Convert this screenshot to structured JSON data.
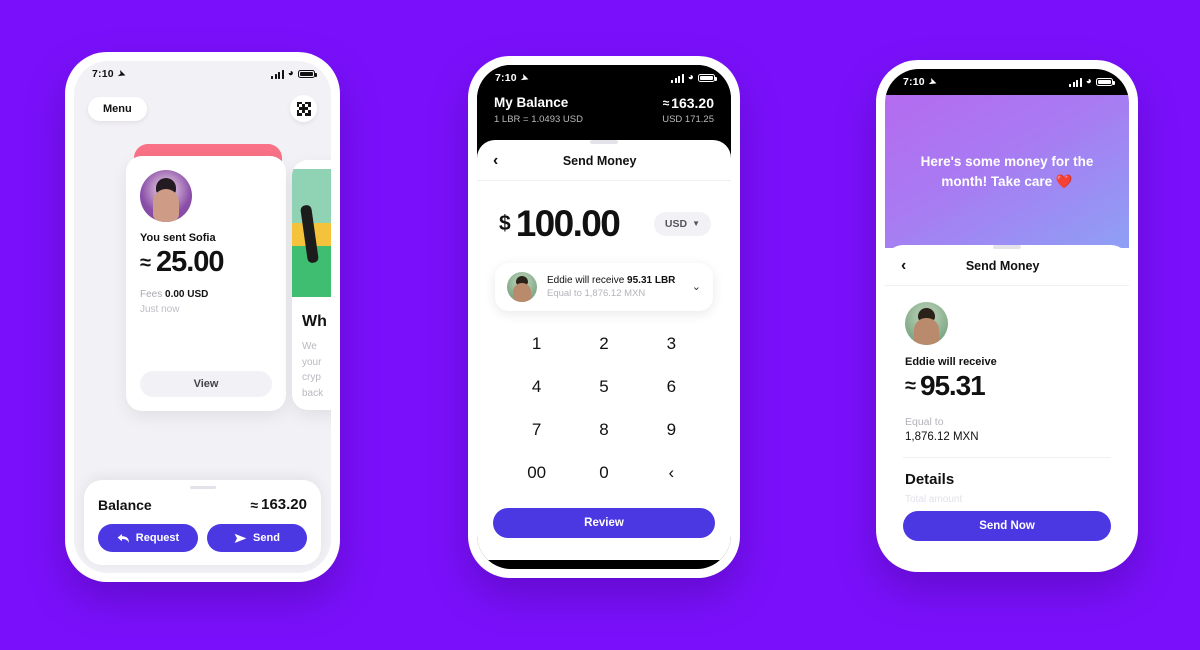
{
  "theme": {
    "background": "#7A10FB",
    "accent": "#4B38E2",
    "pink_card": "#F97186",
    "sheet_bg": "#FFFFFF",
    "screen_bg": "#F2F1F6"
  },
  "phone1": {
    "status": {
      "time": "7:10",
      "location_icon": "location-arrow-icon",
      "signal_icon": "cellular-bars-icon",
      "wifi_icon": "wifi-icon",
      "battery_icon": "battery-icon"
    },
    "menu_button": "Menu",
    "qr_button": "qr-code-icon",
    "receipt_card": {
      "avatar": "sofia-avatar",
      "title": "You sent Sofia",
      "currency_symbol": "≈",
      "amount": "25.00",
      "fees_label": "Fees",
      "fees_value": "0.00 USD",
      "timestamp": "Just now",
      "view_button": "View"
    },
    "peek_card": {
      "title": "Wh",
      "lines": [
        "We ",
        "your",
        "cryp",
        "back"
      ]
    },
    "balance_bar": {
      "label": "Balance",
      "currency_symbol": "≈",
      "value": "163.20",
      "request_button": "Request",
      "request_icon": "reply-arrow-icon",
      "send_button": "Send",
      "send_icon": "paper-plane-icon"
    }
  },
  "phone2": {
    "status": {
      "time": "7:10",
      "location_icon": "location-arrow-icon",
      "signal_icon": "cellular-bars-icon",
      "wifi_icon": "wifi-icon",
      "battery_icon": "battery-icon"
    },
    "header": {
      "title": "My Balance",
      "rate": "1 LBR = 1.0493 USD",
      "currency_symbol": "≈",
      "balance": "163.20",
      "usd_value": "USD 171.25"
    },
    "nav": {
      "back_icon": "chevron-left-icon",
      "title": "Send Money"
    },
    "amount": {
      "symbol": "$",
      "value": "100.00",
      "currency": "USD",
      "chevron": "chevron-down-icon"
    },
    "recipient_card": {
      "avatar": "eddie-avatar",
      "line1_prefix": "Eddie will receive ",
      "line1_amount": "95.31 LBR",
      "line2": "Equal to 1,876.12 MXN",
      "expand_icon": "chevron-down-icon"
    },
    "keypad": [
      "1",
      "2",
      "3",
      "4",
      "5",
      "6",
      "7",
      "8",
      "9",
      "00",
      "0",
      "‹"
    ],
    "review_button": "Review"
  },
  "phone3": {
    "status": {
      "time": "7:10",
      "location_icon": "location-arrow-icon",
      "signal_icon": "cellular-bars-icon",
      "wifi_icon": "wifi-icon",
      "battery_icon": "battery-icon"
    },
    "message": "Here's some money for the month! Take care ❤️",
    "nav": {
      "back_icon": "chevron-left-icon",
      "title": "Send Money"
    },
    "avatar": "eddie-avatar",
    "receive_label": "Eddie will receive",
    "currency_symbol": "≈",
    "receive_amount": "95.31",
    "equal_label": "Equal to",
    "equal_value": "1,876.12 MXN",
    "details_heading": "Details",
    "details_faint": "Total amount",
    "send_button": "Send Now"
  }
}
